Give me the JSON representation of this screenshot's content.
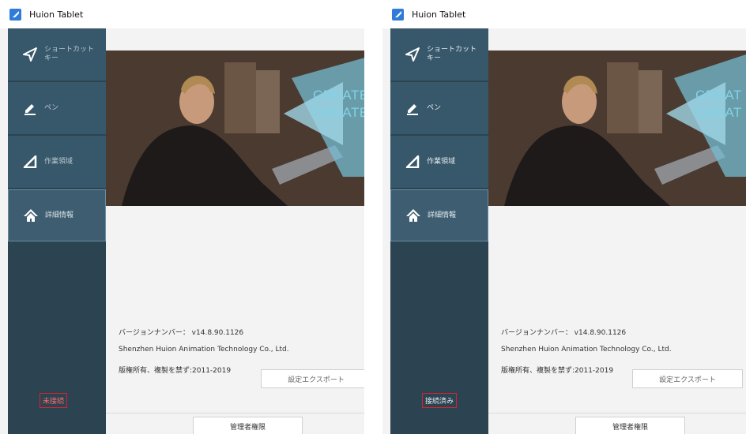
{
  "left": {
    "window_title": "Huion Tablet",
    "nav": [
      {
        "label": "ショートカット\nキー",
        "icon": "paper-plane-icon"
      },
      {
        "label": "ペン",
        "icon": "pen-icon"
      },
      {
        "label": "作業領域",
        "icon": "triangle-area-icon"
      },
      {
        "label": "詳細情報",
        "icon": "home-icon",
        "active": true
      }
    ],
    "hero_text": [
      "CREATE",
      "CREATE"
    ],
    "version": "バージョンナンバー： v14.8.90.1126",
    "company": "Shenzhen Huion Animation Technology Co., Ltd.",
    "copyright": "版権所有、複製を禁ず:2011-2019",
    "export_button": "設定エクスポート",
    "admin_button": "管理者権限",
    "connection_status": "未接続"
  },
  "right": {
    "window_title": "Huion Tablet",
    "nav": [
      {
        "label": "ショートカット\nキー",
        "icon": "paper-plane-icon"
      },
      {
        "label": "ペン",
        "icon": "pen-icon"
      },
      {
        "label": "作業領域",
        "icon": "triangle-area-icon"
      },
      {
        "label": "詳細情報",
        "icon": "home-icon",
        "active": true
      }
    ],
    "hero_text": [
      "CREAT",
      "CREAT"
    ],
    "version": "バージョンナンバー： v14.8.90.1126",
    "company": "Shenzhen Huion Animation Technology Co., Ltd.",
    "copyright": "版権所有、複製を禁ず:2011-2019",
    "export_button": "設定エクスポート",
    "admin_button": "管理者権限",
    "connection_status": "接続済み"
  },
  "colors": {
    "sidebar": "#2c4352",
    "nav_item": "#37576a",
    "status_border": "#d6242a",
    "hero_accent": "#7fd4e8"
  }
}
